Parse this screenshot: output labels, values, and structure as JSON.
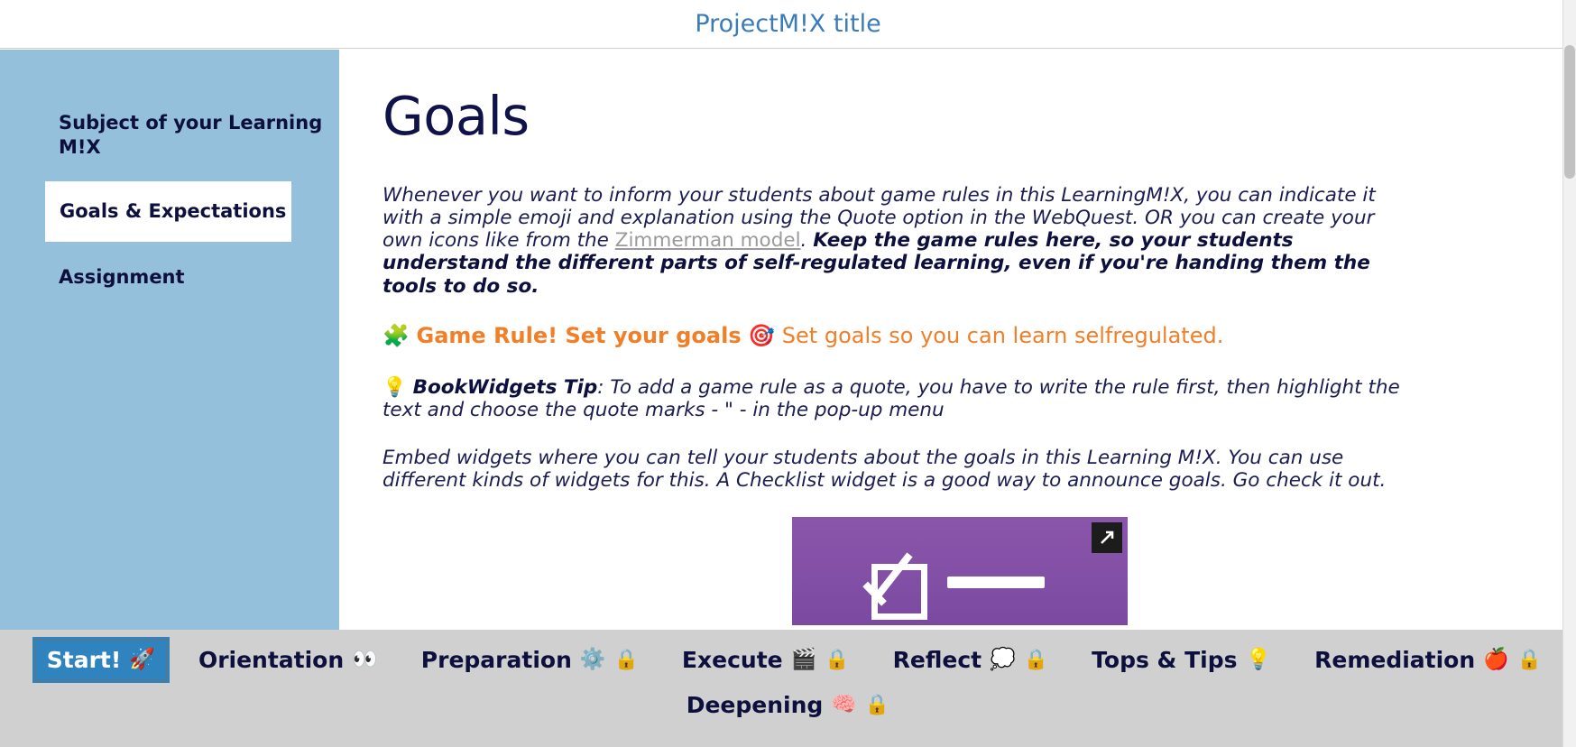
{
  "window": {
    "title": "ProjectM!X title",
    "title_color": "#3a7cb8"
  },
  "sidebar": {
    "background_color": "#95c0dc",
    "items": [
      {
        "label": "Subject of your Learning M!X",
        "selected": false
      },
      {
        "label": "Goals & Expectations",
        "selected": true
      },
      {
        "label": "Assignment",
        "selected": false
      }
    ]
  },
  "main": {
    "page_title": "Goals",
    "paragraph1": {
      "part1": "Whenever you want to inform your students about game rules in this LearningM!X, you can indicate it with a simple emoji and explanation using the Quote option in the WebQuest.  OR you can create your own icons like from the ",
      "link_text": "Zimmerman model",
      "part2": ". ",
      "bold_text": "Keep the game rules here, so your students understand the different parts of self-regulated learning, even if you're handing them the tools to do so."
    },
    "game_rule": {
      "puzzle_icon": "🧩",
      "bold_text": "Game Rule!  Set your goals",
      "target_icon": "🎯",
      "normal_text": "Set goals so you can learn selfregulated.",
      "color": "#f07f28"
    },
    "tip": {
      "bulb_icon": "💡",
      "title": "BookWidgets Tip",
      "text": ": To add a game rule as a quote, you have to write the rule first, then highlight the text and choose the quote marks - \" - in the pop-up menu"
    },
    "paragraph2": "Embed widgets where you can tell your students about the goals in this Learning M!X. You can use different kinds of widgets for this. A Checklist widget is a good way to announce goals. Go check it out.",
    "widget_preview": {
      "type": "checklist-widget",
      "background_color": "#8a56ac",
      "expand_label": "expand"
    }
  },
  "bottom_nav": {
    "background_color": "#d0d0d0",
    "active_color": "#2f84bf",
    "row1": [
      {
        "label": "Start!",
        "emoji": "🚀",
        "locked": false,
        "active": true
      },
      {
        "label": "Orientation",
        "emoji": "👀",
        "locked": false,
        "active": false
      },
      {
        "label": "Preparation",
        "emoji": "⚙️",
        "locked": true,
        "active": false
      },
      {
        "label": "Execute",
        "emoji": "🎬",
        "locked": true,
        "active": false
      },
      {
        "label": "Reflect",
        "emoji": "💭",
        "locked": true,
        "active": false
      },
      {
        "label": "Tops & Tips",
        "emoji": "💡",
        "locked": false,
        "active": false
      },
      {
        "label": "Remediation",
        "emoji": "🍎",
        "locked": true,
        "active": false
      }
    ],
    "row2": [
      {
        "label": "Deepening",
        "emoji": "🧠",
        "locked": true,
        "active": false
      }
    ],
    "lock_icon": "🔒"
  }
}
